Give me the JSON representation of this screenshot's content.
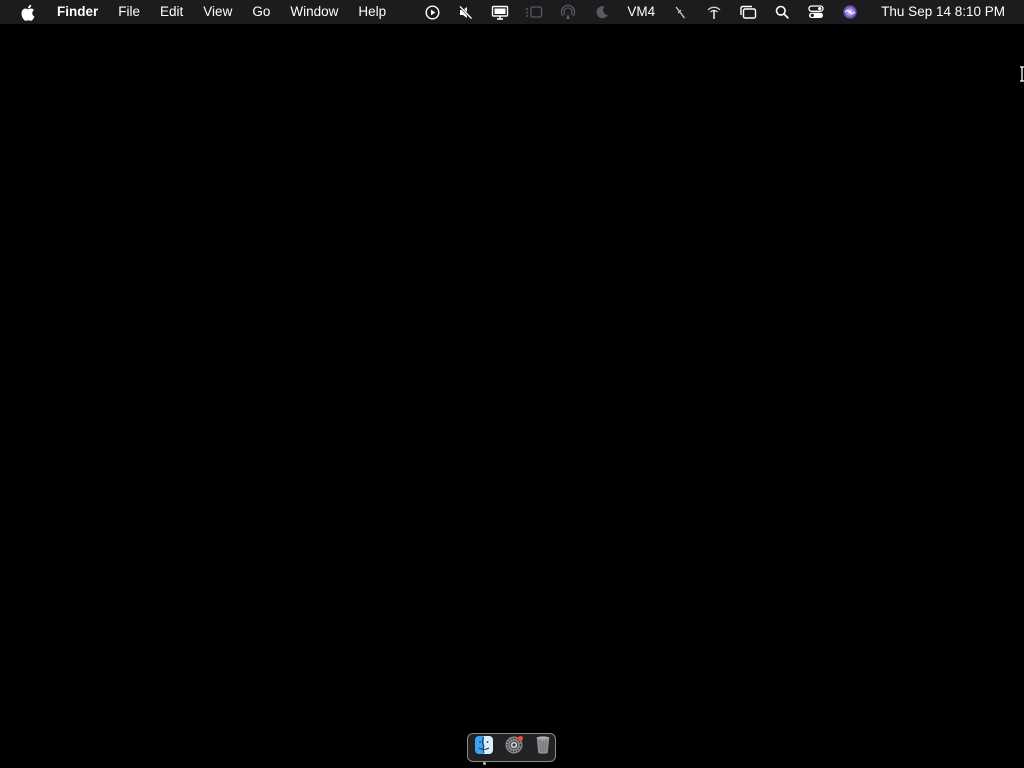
{
  "menubar": {
    "apple_icon": "apple-logo-icon",
    "app_name": "Finder",
    "menus": [
      "File",
      "Edit",
      "View",
      "Go",
      "Window",
      "Help"
    ],
    "status": {
      "vm_label": "VM4",
      "clock": "Thu Sep 14  8:10 PM"
    }
  },
  "dock": {
    "items": [
      {
        "name": "Finder",
        "icon": "finder-icon",
        "running": true
      },
      {
        "name": "System Settings",
        "icon": "system-settings-icon",
        "badge": true
      },
      {
        "name": "Trash",
        "icon": "trash-icon"
      }
    ]
  },
  "colors": {
    "desktop": "#000000",
    "menubar": "#1c1c1e",
    "menu_text": "#ffffff",
    "dock_border": "#8a8a8c"
  }
}
